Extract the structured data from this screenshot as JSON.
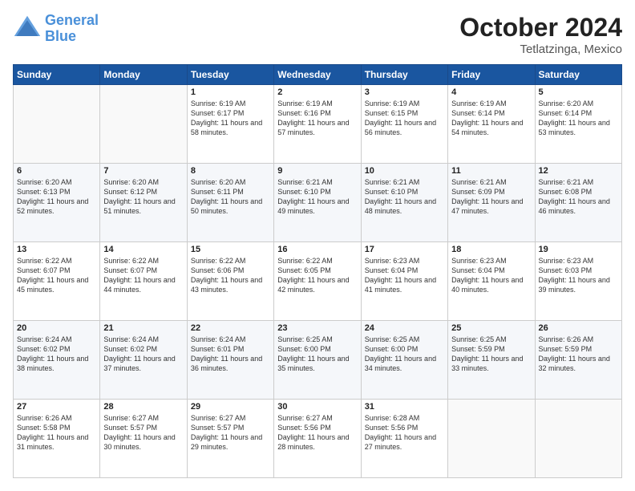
{
  "header": {
    "logo_line1": "General",
    "logo_line2": "Blue",
    "month": "October 2024",
    "location": "Tetlatzinga, Mexico"
  },
  "weekdays": [
    "Sunday",
    "Monday",
    "Tuesday",
    "Wednesday",
    "Thursday",
    "Friday",
    "Saturday"
  ],
  "weeks": [
    [
      {
        "day": "",
        "text": ""
      },
      {
        "day": "",
        "text": ""
      },
      {
        "day": "1",
        "text": "Sunrise: 6:19 AM\nSunset: 6:17 PM\nDaylight: 11 hours and 58 minutes."
      },
      {
        "day": "2",
        "text": "Sunrise: 6:19 AM\nSunset: 6:16 PM\nDaylight: 11 hours and 57 minutes."
      },
      {
        "day": "3",
        "text": "Sunrise: 6:19 AM\nSunset: 6:15 PM\nDaylight: 11 hours and 56 minutes."
      },
      {
        "day": "4",
        "text": "Sunrise: 6:19 AM\nSunset: 6:14 PM\nDaylight: 11 hours and 54 minutes."
      },
      {
        "day": "5",
        "text": "Sunrise: 6:20 AM\nSunset: 6:14 PM\nDaylight: 11 hours and 53 minutes."
      }
    ],
    [
      {
        "day": "6",
        "text": "Sunrise: 6:20 AM\nSunset: 6:13 PM\nDaylight: 11 hours and 52 minutes."
      },
      {
        "day": "7",
        "text": "Sunrise: 6:20 AM\nSunset: 6:12 PM\nDaylight: 11 hours and 51 minutes."
      },
      {
        "day": "8",
        "text": "Sunrise: 6:20 AM\nSunset: 6:11 PM\nDaylight: 11 hours and 50 minutes."
      },
      {
        "day": "9",
        "text": "Sunrise: 6:21 AM\nSunset: 6:10 PM\nDaylight: 11 hours and 49 minutes."
      },
      {
        "day": "10",
        "text": "Sunrise: 6:21 AM\nSunset: 6:10 PM\nDaylight: 11 hours and 48 minutes."
      },
      {
        "day": "11",
        "text": "Sunrise: 6:21 AM\nSunset: 6:09 PM\nDaylight: 11 hours and 47 minutes."
      },
      {
        "day": "12",
        "text": "Sunrise: 6:21 AM\nSunset: 6:08 PM\nDaylight: 11 hours and 46 minutes."
      }
    ],
    [
      {
        "day": "13",
        "text": "Sunrise: 6:22 AM\nSunset: 6:07 PM\nDaylight: 11 hours and 45 minutes."
      },
      {
        "day": "14",
        "text": "Sunrise: 6:22 AM\nSunset: 6:07 PM\nDaylight: 11 hours and 44 minutes."
      },
      {
        "day": "15",
        "text": "Sunrise: 6:22 AM\nSunset: 6:06 PM\nDaylight: 11 hours and 43 minutes."
      },
      {
        "day": "16",
        "text": "Sunrise: 6:22 AM\nSunset: 6:05 PM\nDaylight: 11 hours and 42 minutes."
      },
      {
        "day": "17",
        "text": "Sunrise: 6:23 AM\nSunset: 6:04 PM\nDaylight: 11 hours and 41 minutes."
      },
      {
        "day": "18",
        "text": "Sunrise: 6:23 AM\nSunset: 6:04 PM\nDaylight: 11 hours and 40 minutes."
      },
      {
        "day": "19",
        "text": "Sunrise: 6:23 AM\nSunset: 6:03 PM\nDaylight: 11 hours and 39 minutes."
      }
    ],
    [
      {
        "day": "20",
        "text": "Sunrise: 6:24 AM\nSunset: 6:02 PM\nDaylight: 11 hours and 38 minutes."
      },
      {
        "day": "21",
        "text": "Sunrise: 6:24 AM\nSunset: 6:02 PM\nDaylight: 11 hours and 37 minutes."
      },
      {
        "day": "22",
        "text": "Sunrise: 6:24 AM\nSunset: 6:01 PM\nDaylight: 11 hours and 36 minutes."
      },
      {
        "day": "23",
        "text": "Sunrise: 6:25 AM\nSunset: 6:00 PM\nDaylight: 11 hours and 35 minutes."
      },
      {
        "day": "24",
        "text": "Sunrise: 6:25 AM\nSunset: 6:00 PM\nDaylight: 11 hours and 34 minutes."
      },
      {
        "day": "25",
        "text": "Sunrise: 6:25 AM\nSunset: 5:59 PM\nDaylight: 11 hours and 33 minutes."
      },
      {
        "day": "26",
        "text": "Sunrise: 6:26 AM\nSunset: 5:59 PM\nDaylight: 11 hours and 32 minutes."
      }
    ],
    [
      {
        "day": "27",
        "text": "Sunrise: 6:26 AM\nSunset: 5:58 PM\nDaylight: 11 hours and 31 minutes."
      },
      {
        "day": "28",
        "text": "Sunrise: 6:27 AM\nSunset: 5:57 PM\nDaylight: 11 hours and 30 minutes."
      },
      {
        "day": "29",
        "text": "Sunrise: 6:27 AM\nSunset: 5:57 PM\nDaylight: 11 hours and 29 minutes."
      },
      {
        "day": "30",
        "text": "Sunrise: 6:27 AM\nSunset: 5:56 PM\nDaylight: 11 hours and 28 minutes."
      },
      {
        "day": "31",
        "text": "Sunrise: 6:28 AM\nSunset: 5:56 PM\nDaylight: 11 hours and 27 minutes."
      },
      {
        "day": "",
        "text": ""
      },
      {
        "day": "",
        "text": ""
      }
    ]
  ]
}
